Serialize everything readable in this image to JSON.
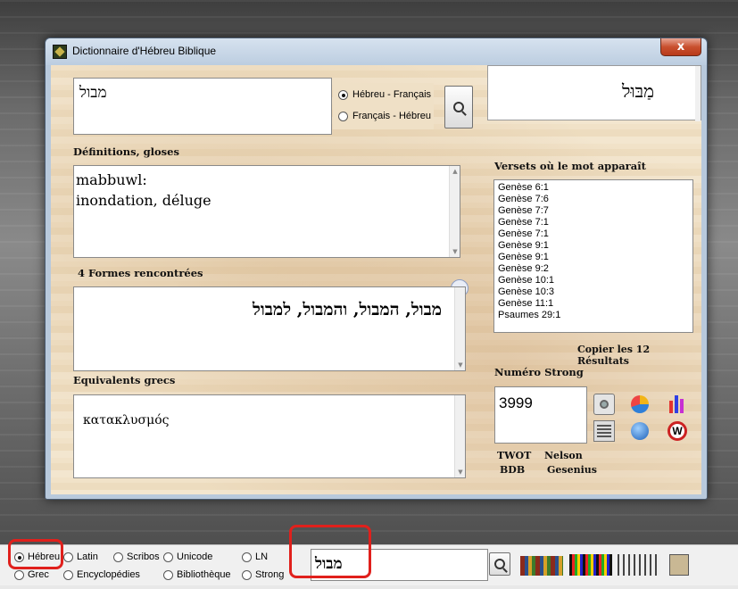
{
  "window": {
    "title": "Dictionnaire d'Hébreu Biblique",
    "close_label": "x"
  },
  "search": {
    "input_value": "מבול",
    "mode_options": [
      "Hébreu - Français",
      "Français - Hébreu"
    ],
    "selected_mode": "Hébreu - Français"
  },
  "vocalized_word": "מַבּוּל",
  "definitions": {
    "label": "Définitions, gloses",
    "lines": [
      "mabbuwl:",
      "inondation, déluge"
    ]
  },
  "forms": {
    "label": "4 Formes rencontrées",
    "text": "מבול, המבול, והמבול, למבול"
  },
  "greek": {
    "label": "Equivalents grecs",
    "text": "κατακλυσμός"
  },
  "verses": {
    "label": "Versets où le mot apparaît",
    "items": [
      "Genèse 6:1",
      "Genèse 7:6",
      "Genèse 7:7",
      "Genèse 7:1",
      "Genèse 7:1",
      "Genèse 9:1",
      "Genèse 9:1",
      "Genèse 9:2",
      "Genèse 10:1",
      "Genèse 10:3",
      "Genèse 11:1",
      "Psaumes 29:1"
    ],
    "copy_label": "Copier les 12 Résultats"
  },
  "strong": {
    "label": "Numéro Strong",
    "value": "3999"
  },
  "references": {
    "twot": "TWOT",
    "nelson": "Nelson",
    "bdb": "BDB",
    "gesenius": "Gesenius"
  },
  "bottombar": {
    "languages_row1": [
      "Hébreu",
      "Latin",
      "Scribos",
      "Unicode",
      "LN"
    ],
    "languages_row2": [
      "Grec",
      "Encyclopédies",
      "Bibliothèque",
      "Strong"
    ],
    "selected_language": "Hébreu",
    "search_value": "מבול"
  },
  "colors": {
    "highlight": "#e0201c",
    "parchment": "#f1e2c8",
    "title_bar": "#bccde0"
  }
}
